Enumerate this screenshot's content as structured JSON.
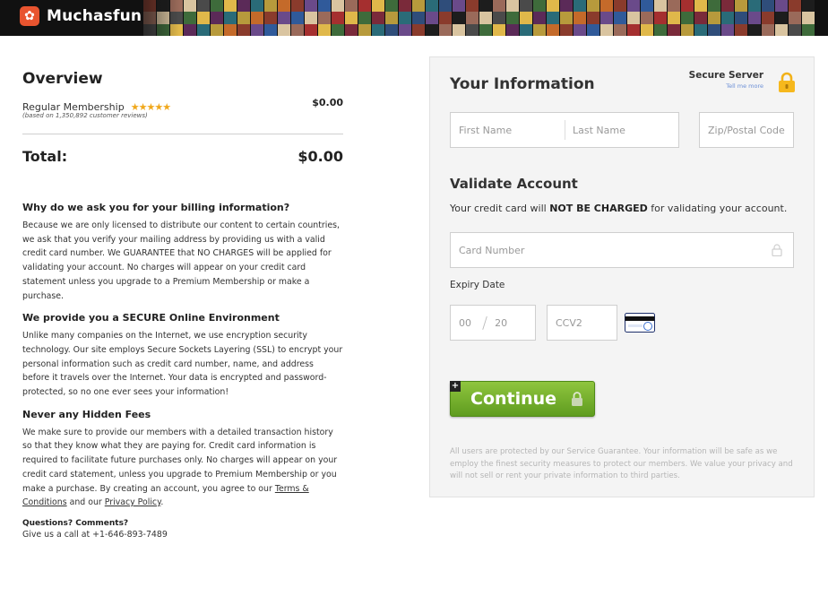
{
  "header": {
    "brand": "Muchasfun",
    "logo_icon": "muchasfun-logo-icon",
    "mosaic_colors": [
      "#8a3b2c",
      "#2f4d7a",
      "#b79a3c",
      "#5b2a58",
      "#3e6b3b",
      "#a52f2f",
      "#d9c4a0",
      "#1d1d1d",
      "#6a4a8a",
      "#c46a2a",
      "#2a6b78",
      "#7a2a3a",
      "#e0b84a",
      "#4a4a4a",
      "#9a6a5a",
      "#305a9a"
    ]
  },
  "overview": {
    "title": "Overview",
    "item_name": "Regular Membership",
    "stars": "★★★★★",
    "rating": 4.5,
    "item_price": "$0.00",
    "reviews": "(based on 1,350,892 customer reviews)",
    "total_label": "Total:",
    "total_value": "$0.00"
  },
  "faq": {
    "q1_title": "Why do we ask you for your billing information?",
    "q1_text": "Because we are only licensed to distribute our content to certain countries, we ask that you verify your mailing address by providing us with a valid credit card number. We GUARANTEE that NO CHARGES will be applied for validating your account. No charges will appear on your credit card statement unless you upgrade to a Premium Membership or make a purchase.",
    "q2_title": "We provide you a SECURE Online Environment",
    "q2_text": "Unlike many companies on the Internet, we use encryption security technology. Our site employs Secure Sockets Layering (SSL) to encrypt your personal information such as credit card number, name, and address before it travels over the Internet. Your data is encrypted and password-protected, so no one ever sees your information!",
    "q3_title": "Never any Hidden Fees",
    "q3_text": "We make sure to provide our members with a detailed transaction history so that they know what they are paying for. Credit card information is required to facilitate future purchases only. No charges will appear on your credit card statement, unless you upgrade to Premium Membership or you make a purchase. By creating an account, you agree to our",
    "terms_link": "Terms & Conditions",
    "and_text": "and our",
    "privacy_link": "Privacy Policy",
    "period": ".",
    "contact_title": "Questions? Comments?",
    "contact_text": "Give us a call at +1-646-893-7489"
  },
  "form": {
    "info_title": "Your Information",
    "secure_title": "Secure Server",
    "secure_more": "Tell me more",
    "first_name_placeholder": "First Name",
    "last_name_placeholder": "Last Name",
    "zip_placeholder": "Zip/Postal Code",
    "validate_title": "Validate Account",
    "validate_pre": "Your credit card will",
    "validate_bold": "NOT BE CHARGED",
    "validate_post": "for validating your account.",
    "card_placeholder": "Card Number",
    "expiry_label": "Expiry Date",
    "month_value": "00",
    "year_value": "20",
    "slash": "/",
    "ccv_placeholder": "CCV2",
    "continue_label": "Continue",
    "plus": "+",
    "guarantee": "All users are protected by our Service Guarantee. Your information will be safe as we employ the finest security measures to protect our members. We value your privacy and will not sell or rent your private information to third parties."
  }
}
